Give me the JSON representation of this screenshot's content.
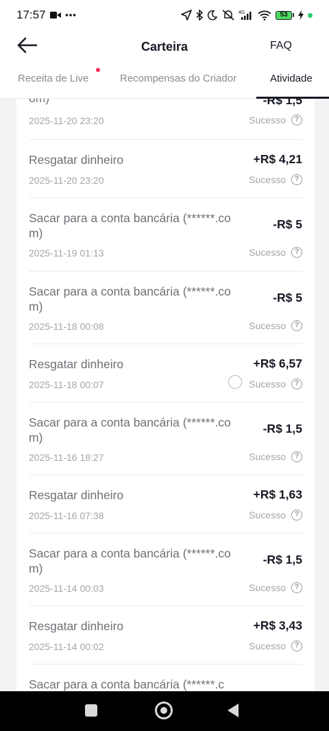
{
  "status_bar": {
    "time": "17:57",
    "battery_level": "53",
    "network": "4G",
    "left_icons": [
      "video-camera-icon",
      "more-dots-icon"
    ],
    "right_icons": [
      "navigation-icon",
      "bluetooth-icon",
      "do-not-disturb-icon",
      "notifications-off-icon",
      "signal-icon",
      "wifi-icon",
      "battery-icon",
      "charging-icon"
    ]
  },
  "header": {
    "title": "Carteira",
    "faq_label": "FAQ",
    "back_icon": "arrow-left-icon"
  },
  "tabs": [
    {
      "label": "Receita de Live",
      "active": false,
      "has_dot": true
    },
    {
      "label": "Recompensas do Criador",
      "active": false,
      "has_dot": false
    },
    {
      "label": "Atividade",
      "active": true,
      "has_dot": false
    }
  ],
  "transactions": [
    {
      "title": "om)",
      "amount": "-R$ 1,5",
      "date": "2025-11-20 23:20",
      "status": "Sucesso"
    },
    {
      "title": "Resgatar dinheiro",
      "amount": "+R$ 4,21",
      "date": "2025-11-20 23:20",
      "status": "Sucesso"
    },
    {
      "title": "Sacar para a conta bancária (******.com)",
      "amount": "-R$ 5",
      "date": "2025-11-19 01:13",
      "status": "Sucesso"
    },
    {
      "title": "Sacar para a conta bancária (******.com)",
      "amount": "-R$ 5",
      "date": "2025-11-18 00:08",
      "status": "Sucesso"
    },
    {
      "title": "Resgatar dinheiro",
      "amount": "+R$ 6,57",
      "date": "2025-11-18 00:07",
      "status": "Sucesso"
    },
    {
      "title": "Sacar para a conta bancária (******.com)",
      "amount": "-R$ 1,5",
      "date": "2025-11-16 18:27",
      "status": "Sucesso"
    },
    {
      "title": "Resgatar dinheiro",
      "amount": "+R$ 1,63",
      "date": "2025-11-16 07:38",
      "status": "Sucesso"
    },
    {
      "title": "Sacar para a conta bancária (******.com)",
      "amount": "-R$ 1,5",
      "date": "2025-11-14 00:03",
      "status": "Sucesso"
    },
    {
      "title": "Resgatar dinheiro",
      "amount": "+R$ 3,43",
      "date": "2025-11-14 00:02",
      "status": "Sucesso"
    },
    {
      "title": "Sacar para a conta bancária (******.c",
      "amount": "",
      "date": "",
      "status": ""
    }
  ],
  "help_glyph": "?",
  "colors": {
    "accent_dot": "#fe2c55",
    "text_primary": "#161823",
    "text_secondary": "#a4a5aa",
    "background": "#f3f3f5"
  }
}
